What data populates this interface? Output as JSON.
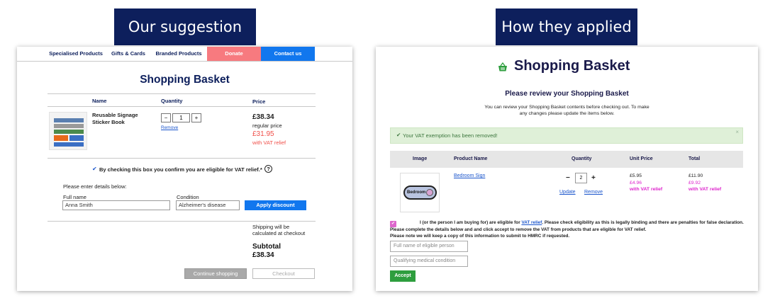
{
  "headers": {
    "left": "Our suggestion",
    "right": "How they applied"
  },
  "left": {
    "nav": {
      "specialised": "Specialised Products",
      "gifts": "Gifts & Cards",
      "branded": "Branded Products",
      "donate": "Donate",
      "contact": "Contact us"
    },
    "title": "Shopping Basket",
    "columns": {
      "name": "Name",
      "quantity": "Quantity",
      "price": "Price"
    },
    "item": {
      "name_line1": "Reusable Signage",
      "name_line2": "Sticker Book",
      "minus": "−",
      "qty": "1",
      "plus": "+",
      "remove": "Remove",
      "price": "£38.34",
      "regular": "regular price",
      "vat_price": "£31.95",
      "vat_label": "with VAT relief"
    },
    "vat_check": {
      "checkmark": "✔",
      "label": "By checking this box you confirm you are eligible for VAT relief.*",
      "help": "?"
    },
    "details": {
      "intro": "Please enter details below:",
      "fullname_label": "Full name",
      "fullname_value": "Anna Smith",
      "condition_label": "Condition",
      "condition_value": "Alzheimer's disease",
      "apply": "Apply discount"
    },
    "shipping_line1": "Shipping will be",
    "shipping_line2": "calculated at checkout",
    "subtotal_label": "Subtotal",
    "subtotal_value": "£38.34",
    "continue": "Continue shopping",
    "checkout": "Checkout"
  },
  "right": {
    "title": "Shopping Basket",
    "review_title": "Please review your Shopping Basket",
    "review_line1": "You can review your Shopping Basket contents before checking out. To make",
    "review_line2": "any changes please update the items below.",
    "alert": "Your VAT exemption has been removed!",
    "alert_check": "✔",
    "alert_close": "×",
    "columns": {
      "image": "Image",
      "product": "Product Name",
      "quantity": "Quantity",
      "unit_price": "Unit Price",
      "total": "Total"
    },
    "item": {
      "name": "Bedroom Sign",
      "badge_text": "Bedroom",
      "minus": "−",
      "qty": "2",
      "plus": "+",
      "update": "Update",
      "remove": "Remove",
      "unit_price": "£5.95",
      "unit_vat": "£4.96",
      "unit_vat_label": "with VAT relief",
      "total": "£11.90",
      "total_vat": "£9.92",
      "total_vat_label": "with VAT relief"
    },
    "declaration": {
      "checkmark": "✔",
      "part1": "I (or the person I am buying for) are eligible for ",
      "link": "VAT relief",
      "part2": ". Please check eligibility as this is legally binding and there are penalties for false declaration.",
      "line2": "Please complete the details below and and click accept to remove the VAT from products that are eligible for VAT relief.",
      "line3": "Please note we will keep a copy of this information to submit to HMRC if requested."
    },
    "placeholders": {
      "name": "Full name of eligible person",
      "condition": "Qualifying medical condition"
    },
    "accept": "Accept"
  },
  "colors": {
    "navy": "#0d1f5c",
    "donate": "#f77a7f",
    "blue": "#1177ee",
    "vat_red": "#f0504a",
    "vat_pink": "#dd22cc",
    "success_bg": "#dff0d8",
    "success_text": "#3c763d",
    "accept_green": "#2e9e3e"
  },
  "icons": {
    "basket": "basket-icon",
    "help": "question-circle-icon",
    "check": "checkmark-icon",
    "close": "close-icon"
  }
}
